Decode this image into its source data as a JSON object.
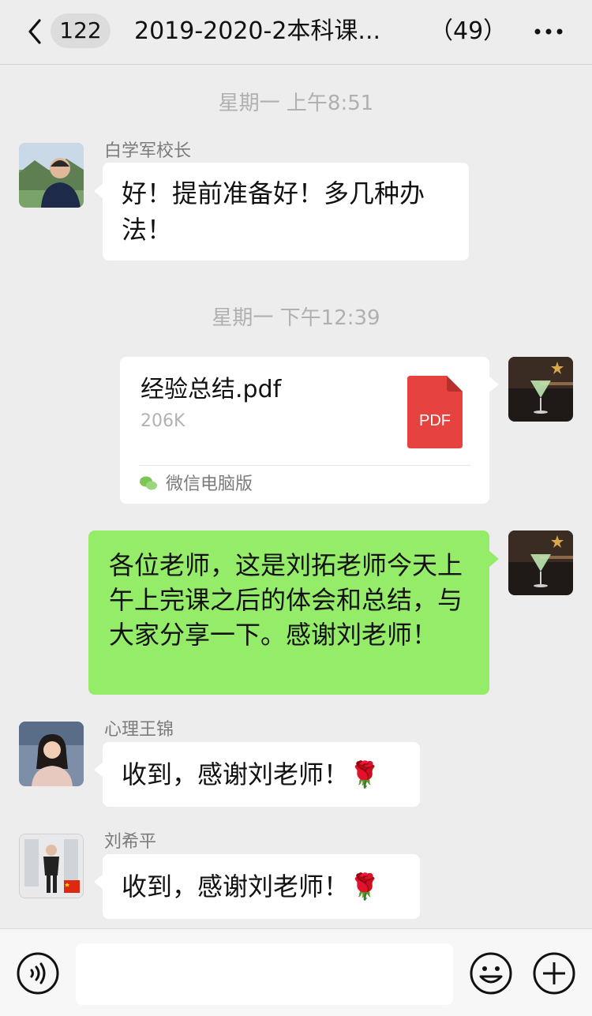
{
  "header": {
    "unread_count": "122",
    "title": "2019-2020-2本科课...",
    "member_count": "（49）"
  },
  "timestamps": [
    "星期一 上午8:51",
    "星期一 下午12:39"
  ],
  "messages": [
    {
      "sender": "白学军校长",
      "text": "好！提前准备好！多几种办法！"
    },
    {
      "file_name": "经验总结.pdf",
      "file_size": "206K",
      "file_type": "PDF",
      "file_source": "微信电脑版"
    },
    {
      "text": "各位老师，这是刘拓老师今天上午上完课之后的体会和总结，与大家分享一下。感谢刘老师！"
    },
    {
      "sender": "心理王锦",
      "text": "收到，感谢刘老师！🌹"
    },
    {
      "sender": "刘希平",
      "text": "收到，感谢刘老师！🌹"
    }
  ],
  "colors": {
    "background": "#ededed",
    "self_bubble": "#95ec69",
    "other_bubble": "#ffffff",
    "pdf_icon": "#e64340"
  },
  "icons": [
    "back-arrow-icon",
    "more-icon",
    "voice-icon",
    "emoji-icon",
    "plus-icon",
    "pdf-file-icon",
    "wechat-pc-icon",
    "rose-emoji"
  ]
}
